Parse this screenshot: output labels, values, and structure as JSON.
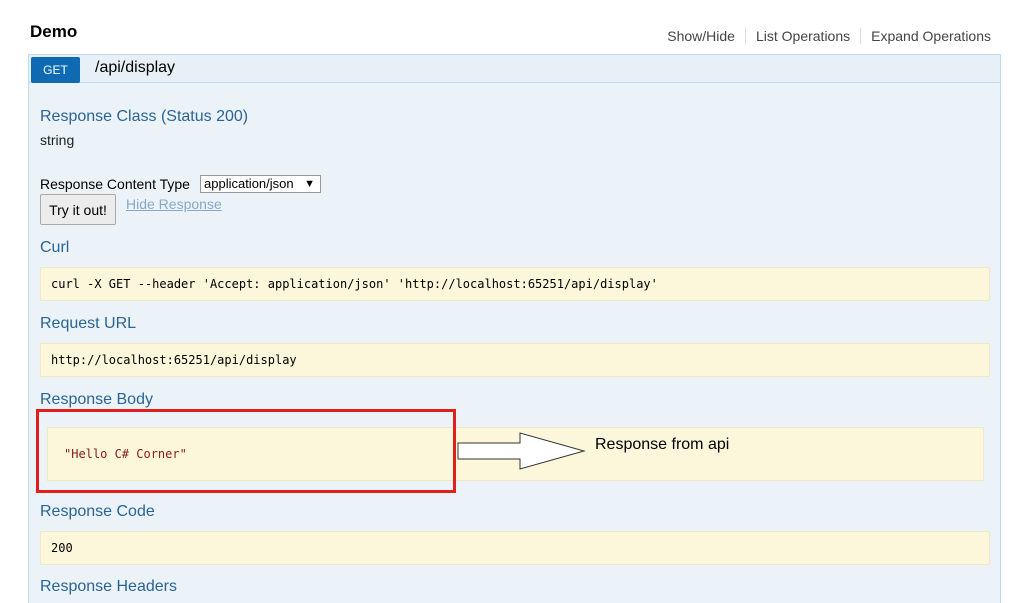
{
  "api": {
    "title": "Demo"
  },
  "header": {
    "links": [
      "Show/Hide",
      "List Operations",
      "Expand Operations"
    ]
  },
  "operation": {
    "method": "GET",
    "path": "/api/display"
  },
  "response_class": {
    "heading": "Response Class (Status 200)",
    "value": "string"
  },
  "content_type": {
    "label": "Response Content Type",
    "selected": "application/json"
  },
  "actions": {
    "try_label": "Try it out!",
    "hide_label": "Hide Response"
  },
  "curl": {
    "heading": "Curl",
    "command": "curl -X GET --header 'Accept: application/json' 'http://localhost:65251/api/display'"
  },
  "request_url": {
    "heading": "Request URL",
    "value": "http://localhost:65251/api/display"
  },
  "response_body": {
    "heading": "Response Body",
    "value": "\"Hello C# Corner\""
  },
  "annotation": {
    "text": "Response from api"
  },
  "response_code": {
    "heading": "Response Code",
    "value": "200"
  },
  "response_headers": {
    "heading": "Response Headers"
  },
  "colors": {
    "get_badge": "#0f6ab4",
    "heading": "#2a6496",
    "code_bg": "#fcf6db",
    "highlight": "#e0201b"
  }
}
